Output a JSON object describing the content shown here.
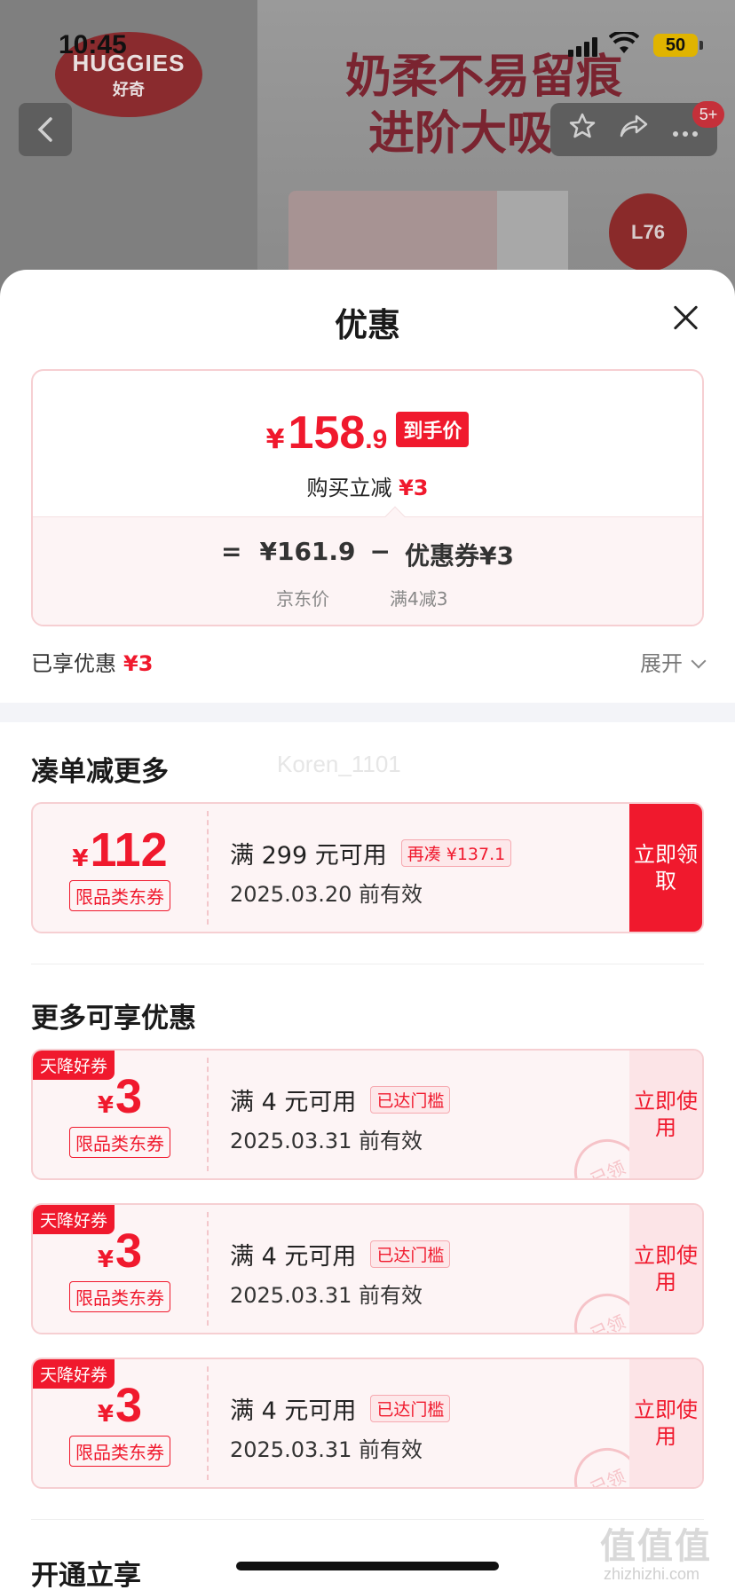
{
  "status_bar": {
    "time": "10:45",
    "battery": "50"
  },
  "banner": {
    "brand_logo_en": "HUGGIES",
    "brand_logo_cn": "好奇",
    "slogan_line1": "奶柔不易留痕",
    "slogan_line2": "进阶大吸量",
    "size_badge": "L76",
    "notif_count": "5+"
  },
  "sheet": {
    "title": "优惠",
    "price_card": {
      "currency": "¥",
      "final_int": "158",
      "final_dec": ".9",
      "final_tag": "到手价",
      "instant_label": "购买立减",
      "instant_value": "¥3",
      "formula_eq": "=",
      "jd_price": "¥161.9",
      "minus": "−",
      "coupon_label": "优惠券¥3",
      "jd_price_caption": "京东价",
      "coupon_caption": "满4减3"
    },
    "enjoyed": {
      "label": "已享优惠",
      "value": "¥3",
      "expand": "展开"
    },
    "section_more": "凑单减更多",
    "watermark_user": "Koren_1101",
    "section_extra": "更多可享优惠",
    "section_open": "开通立享"
  },
  "coupons_bundle": [
    {
      "currency": "¥",
      "amount": "112",
      "type": "限品类东券",
      "condition": "满 299 元可用",
      "gap": "再凑 ¥137.1",
      "valid": "2025.03.20 前有效",
      "action": "立即领取"
    }
  ],
  "coupons_more": [
    {
      "corner": "天降好券",
      "currency": "¥",
      "amount": "3",
      "type": "限品类东券",
      "condition": "满 4 元可用",
      "status": "已达门槛",
      "valid": "2025.03.31 前有效",
      "action": "立即使用",
      "stamp": "已领"
    },
    {
      "corner": "天降好券",
      "currency": "¥",
      "amount": "3",
      "type": "限品类东券",
      "condition": "满 4 元可用",
      "status": "已达门槛",
      "valid": "2025.03.31 前有效",
      "action": "立即使用",
      "stamp": "已领"
    },
    {
      "corner": "天降好券",
      "currency": "¥",
      "amount": "3",
      "type": "限品类东券",
      "condition": "满 4 元可用",
      "status": "已达门槛",
      "valid": "2025.03.31 前有效",
      "action": "立即使用",
      "stamp": "已领"
    }
  ],
  "footer": {
    "site_mark": "值值值",
    "site_url": "zhizhizhi.com"
  },
  "colors": {
    "accent": "#f0192d",
    "card_bg": "#fdf4f5",
    "card_border": "#f6cfd2"
  },
  "icons": [
    "back-arrow-icon",
    "star-icon",
    "share-icon",
    "more-icon",
    "close-icon",
    "chevron-down-icon",
    "signal-icon",
    "wifi-icon",
    "battery-icon"
  ]
}
